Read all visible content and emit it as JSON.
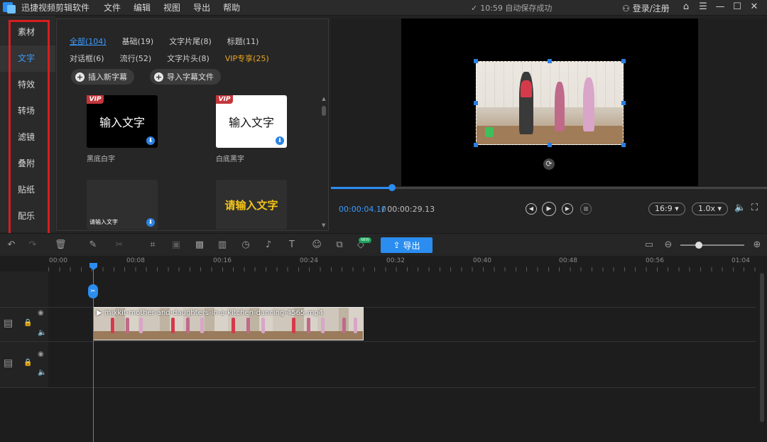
{
  "app": {
    "title": "迅捷视频剪辑软件"
  },
  "menu": [
    "文件",
    "编辑",
    "视图",
    "导出",
    "帮助"
  ],
  "status": {
    "time": "10:59",
    "text": "自动保存成功"
  },
  "account": {
    "login": "登录/注册"
  },
  "leftnav": [
    "素材",
    "文字",
    "特效",
    "转场",
    "滤镜",
    "叠附",
    "贴纸",
    "配乐"
  ],
  "categories_row1": [
    "全部(104)",
    "基础(19)",
    "文字片尾(8)",
    "标题(11)"
  ],
  "categories_row2": [
    "对话框(6)",
    "流行(52)",
    "文字片头(8)",
    "VIP专享(25)"
  ],
  "buttons": {
    "insert": "插入新字幕",
    "import": "导入字幕文件",
    "export": "导出"
  },
  "templates": [
    {
      "preview": "输入文字",
      "label": "黑底白字",
      "vip": "VIP"
    },
    {
      "preview": "输入文字",
      "label": "白底黑字",
      "vip": "VIP"
    },
    {
      "preview": "请输入文字",
      "label": ""
    },
    {
      "preview": "请输入文字",
      "label": ""
    }
  ],
  "player": {
    "current": "00:00:04.10",
    "total": "/ 00:00:29.13",
    "ratio": "16:9",
    "speed": "1.0x",
    "progress": 0.14
  },
  "ruler": [
    "00:00",
    "00:08",
    "00:16",
    "00:24",
    "00:32",
    "00:40",
    "00:48",
    "00:56",
    "01:04"
  ],
  "clip": {
    "title": "mixkit-mother-and-daughters-in-a-kitchen-dancing-4565.mp4"
  },
  "badges": {
    "new": "NEW"
  },
  "colors": {
    "accent": "#2b8df0",
    "vip": "#e8a321",
    "highlight": "#d81e1e"
  }
}
